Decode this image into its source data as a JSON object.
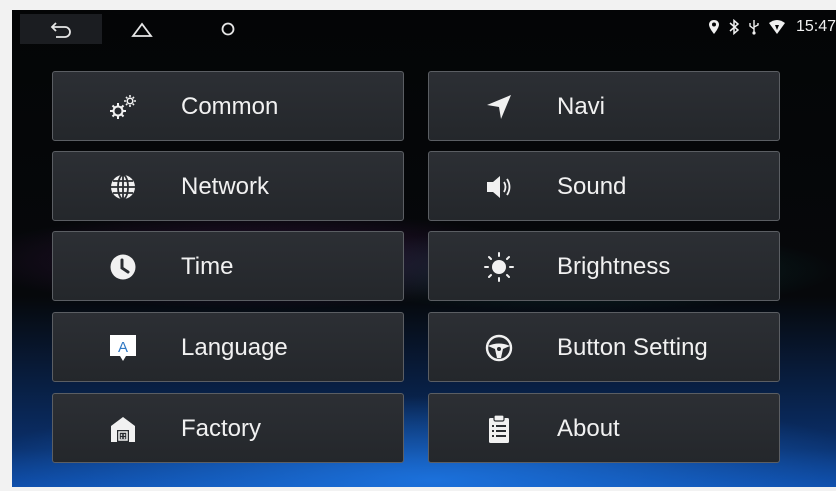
{
  "statusbar": {
    "time": "15:47",
    "icons": [
      "location-icon",
      "bluetooth-icon",
      "usb-icon",
      "wifi-icon"
    ]
  },
  "navbar": {
    "icons": [
      "back-icon",
      "home-icon",
      "recent-apps-icon"
    ]
  },
  "menu": {
    "left": [
      {
        "label": "Common",
        "icon": "gears-icon"
      },
      {
        "label": "Network",
        "icon": "globe-icon"
      },
      {
        "label": "Time",
        "icon": "clock-icon"
      },
      {
        "label": "Language",
        "icon": "language-icon"
      },
      {
        "label": "Factory",
        "icon": "factory-icon"
      }
    ],
    "right": [
      {
        "label": "Navi",
        "icon": "navigation-arrow-icon"
      },
      {
        "label": "Sound",
        "icon": "speaker-icon"
      },
      {
        "label": "Brightness",
        "icon": "sun-icon"
      },
      {
        "label": "Button Setting",
        "icon": "steering-wheel-icon"
      },
      {
        "label": "About",
        "icon": "clipboard-icon"
      }
    ]
  },
  "colors": {
    "tile_bg": "#2a2d31",
    "tile_border": "#5b5e63",
    "text": "#f1f1f1",
    "accent_blue": "#0d4aa5"
  }
}
